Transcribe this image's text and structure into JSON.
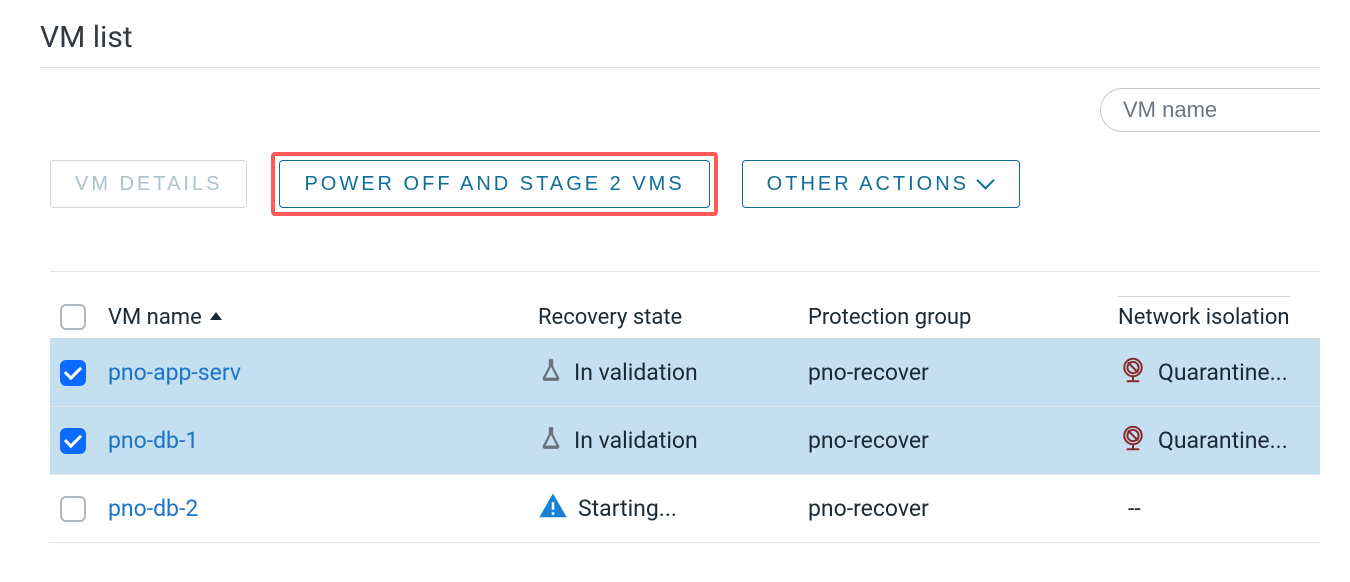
{
  "page_title": "VM list",
  "search": {
    "placeholder": "VM name"
  },
  "actions": {
    "details": "VM DETAILS",
    "power_off_stage": "POWER OFF AND STAGE 2 VMS",
    "other": "OTHER ACTIONS"
  },
  "columns": {
    "name": "VM name",
    "state": "Recovery state",
    "group": "Protection group",
    "isolation": "Network isolation"
  },
  "rows": [
    {
      "selected": true,
      "name": "pno-app-serv",
      "state": "In validation",
      "state_icon": "flask",
      "group": "pno-recover",
      "isolation": "Quarantine...",
      "isolation_icon": "quarantine"
    },
    {
      "selected": true,
      "name": "pno-db-1",
      "state": "In validation",
      "state_icon": "flask",
      "group": "pno-recover",
      "isolation": "Quarantine...",
      "isolation_icon": "quarantine"
    },
    {
      "selected": false,
      "name": "pno-db-2",
      "state": "Starting...",
      "state_icon": "warn",
      "group": "pno-recover",
      "isolation": "--",
      "isolation_icon": "none"
    }
  ]
}
